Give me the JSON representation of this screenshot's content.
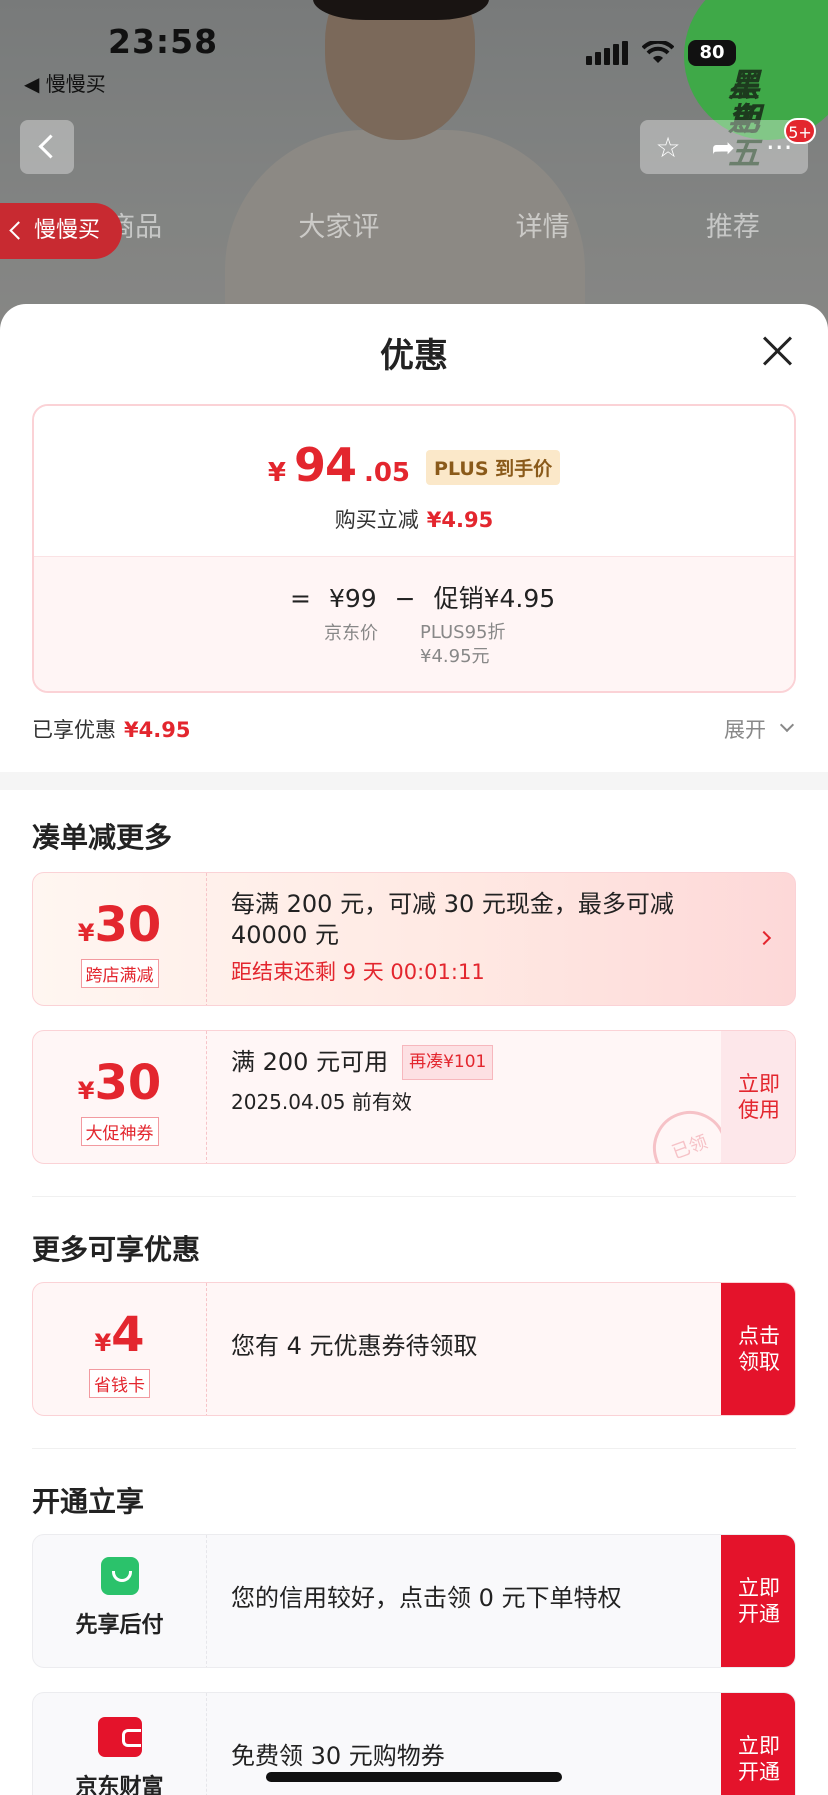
{
  "status_bar": {
    "time": "23:58",
    "back_app": "◀ 慢慢买",
    "battery": "80"
  },
  "promo_badge": {
    "text_line1": "黑色",
    "text_line2": "星期五"
  },
  "product_nav": {
    "notification_count": "5+",
    "float_back_label": "慢慢买",
    "tabs": [
      "商品",
      "大家评",
      "详情",
      "推荐"
    ],
    "action_icons": [
      "star-icon",
      "share-icon",
      "more-icon"
    ]
  },
  "sheet": {
    "title": "优惠",
    "price_card": {
      "yen": "¥",
      "price_int": "94",
      "price_dec": ".05",
      "plus_tag": "PLUS 到手价",
      "sub_label": "购买立减",
      "sub_value": "¥4.95",
      "eq": "=",
      "jd_price": "¥99",
      "minus": "−",
      "promo_label": "促销¥4.95",
      "jd_price_note": "京东价",
      "promo_note_1": "PLUS95折",
      "promo_note_2": "¥4.95元"
    },
    "enjoyed_label": "已享优惠",
    "enjoyed_value": "¥4.95",
    "expand_label": "展开",
    "section_more": {
      "title": "凑单减更多",
      "coupon1": {
        "yen": "¥",
        "amount": "30",
        "tag": "跨店满减",
        "line1": "每满 200 元，可减 30 元现金，最多可减",
        "line2": "40000 元",
        "countdown": "距结束还剩 9 天 00:01:11"
      },
      "coupon2": {
        "yen": "¥",
        "amount": "30",
        "tag": "大促神券",
        "line1": "满 200 元可用",
        "extra_tag": "再凑¥101",
        "line2": "2025.04.05 前有效",
        "action_1": "立即",
        "action_2": "使用",
        "stamp": "已领"
      }
    },
    "section_enjoy": {
      "title": "更多可享优惠",
      "coupon": {
        "yen": "¥",
        "amount": "4",
        "tag": "省钱卡",
        "text": "您有 4 元优惠券待领取",
        "action_1": "点击",
        "action_2": "领取"
      }
    },
    "section_open": {
      "title": "开通立享",
      "items": [
        {
          "label": "先享后付",
          "text": "您的信用较好，点击领 0 元下单特权",
          "action_1": "立即",
          "action_2": "开通"
        },
        {
          "label": "京东财富",
          "text": "免费领 30 元购物券",
          "action_1": "立即",
          "action_2": "开通"
        }
      ]
    }
  }
}
